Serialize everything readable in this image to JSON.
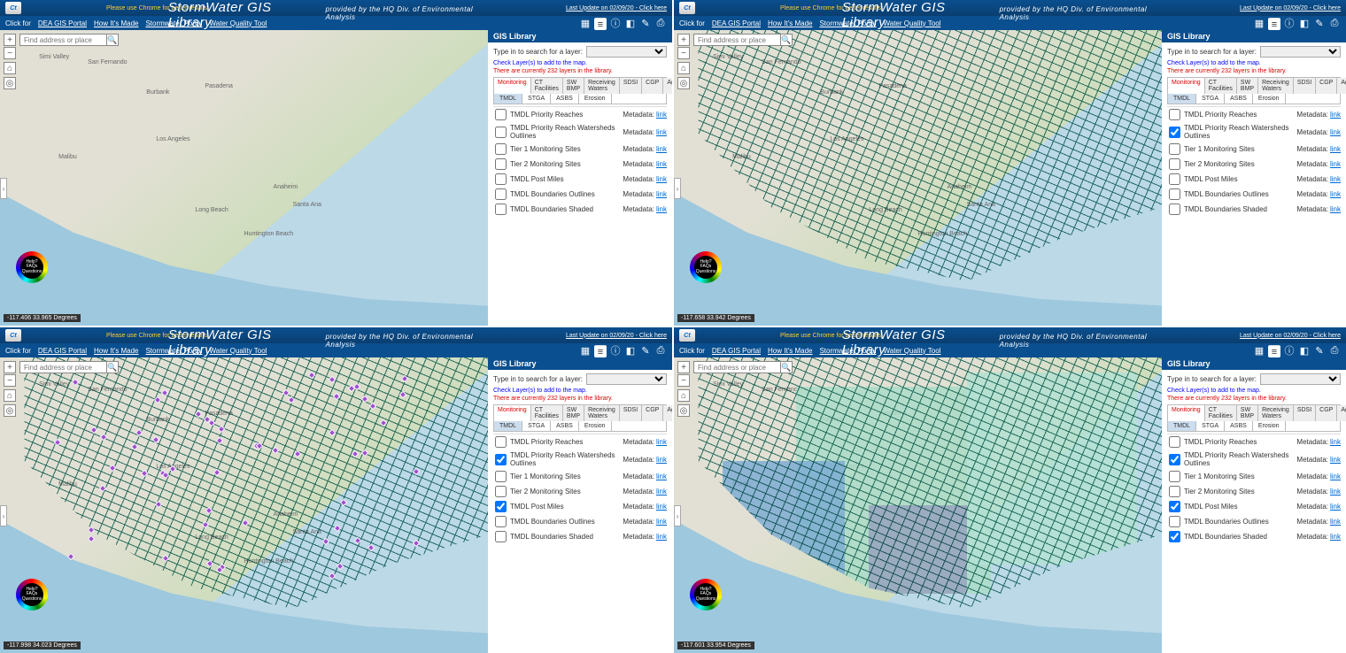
{
  "header": {
    "chrome_note": "Please use Chrome for better results",
    "title": "StormWater GIS Library",
    "subtitle": "provided by the HQ Div.  of Environmental Analysis",
    "last_update": "Last Update on 02/09/20 - Click here"
  },
  "nav": {
    "prefix": "Click for",
    "links": [
      "DEA GIS Portal",
      "How It's Made",
      "Stormwater Portal",
      "Water Quality Tool"
    ]
  },
  "search_placeholder": "Find address or place",
  "wheel_text": "Help? FAQs Questions",
  "sidebar": {
    "title": "GIS Library",
    "search_label": "Type in to search for a layer:",
    "note1": "Check Layer(s) to add to the map.",
    "note2": "There are currently 232 layers in the library.",
    "tabs": [
      "Monitoring",
      "CT Facilities",
      "SW BMP",
      "Receiving Waters",
      "SDSI",
      "CGP",
      "Agencies"
    ],
    "subtabs": [
      "TMDL",
      "STGA",
      "ASBS",
      "Erosion"
    ],
    "meta_label": "Metadata:",
    "link_label": "link",
    "layers": [
      "TMDL Priority Reaches",
      "TMDL Priority Reach Watersheds Outlines",
      "Tier 1 Monitoring Sites",
      "Tier 2 Monitoring Sites",
      "TMDL Post Miles",
      "TMDL Boundaries Outlines",
      "TMDL Boundaries Shaded"
    ]
  },
  "map_cities": [
    "San Fernando",
    "Pasadena",
    "Burbank",
    "Los Angeles",
    "Anaheim",
    "Long Beach",
    "Santa Ana",
    "Malibu",
    "Huntington Beach",
    "Simi Valley"
  ],
  "panels": [
    {
      "coords": "-117.406 33.965 Degrees",
      "checked": [],
      "overlays": []
    },
    {
      "coords": "-117.658 33.942 Degrees",
      "checked": [
        1
      ],
      "overlays": [
        "outlines"
      ]
    },
    {
      "coords": "-117.998 34.023 Degrees",
      "checked": [
        1,
        4
      ],
      "overlays": [
        "outlines",
        "points"
      ]
    },
    {
      "coords": "-117.601 33.954 Degrees",
      "checked": [
        1,
        4,
        6
      ],
      "overlays": [
        "shaded",
        "outlines"
      ]
    }
  ]
}
